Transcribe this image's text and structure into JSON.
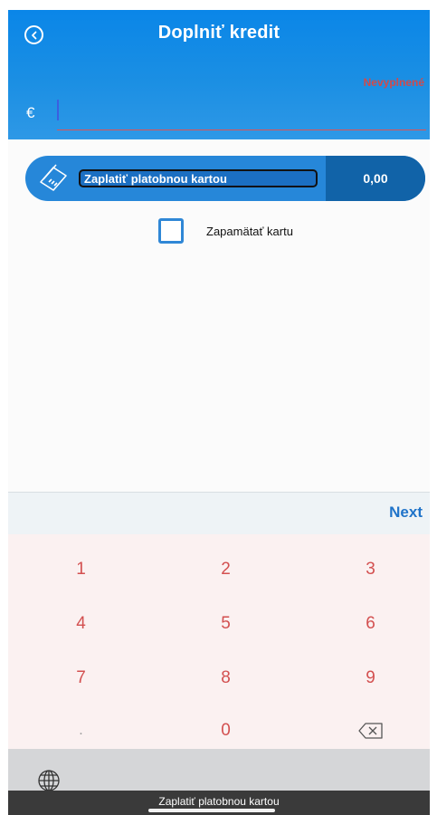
{
  "header": {
    "title": "Doplniť kredit",
    "error_text": "Nevyplnené",
    "currency_symbol": "€",
    "amount_value": "",
    "back_icon": "chevron-left-circle-icon"
  },
  "payment": {
    "button_label": "Zaplatiť platobnou kartou",
    "amount": "0,00",
    "card_icon": "credit-card-icon"
  },
  "remember": {
    "label": "Zapamätať kartu",
    "checked": false
  },
  "keyboard": {
    "next_label": "Next",
    "keys": [
      "1",
      "2",
      "3",
      "4",
      "5",
      "6",
      "7",
      "8",
      "9",
      ".",
      "0"
    ],
    "backspace_icon": "backspace-icon",
    "globe_icon": "globe-icon"
  },
  "tooltip": {
    "text": "Zaplatiť platobnou kartou"
  },
  "colors": {
    "header_blue": "#0a86e8",
    "button_blue": "#2687d9",
    "amount_dark_blue": "#1163a8",
    "error_red": "#d24a4a",
    "key_red": "#d35050",
    "next_blue": "#1f73c9"
  }
}
